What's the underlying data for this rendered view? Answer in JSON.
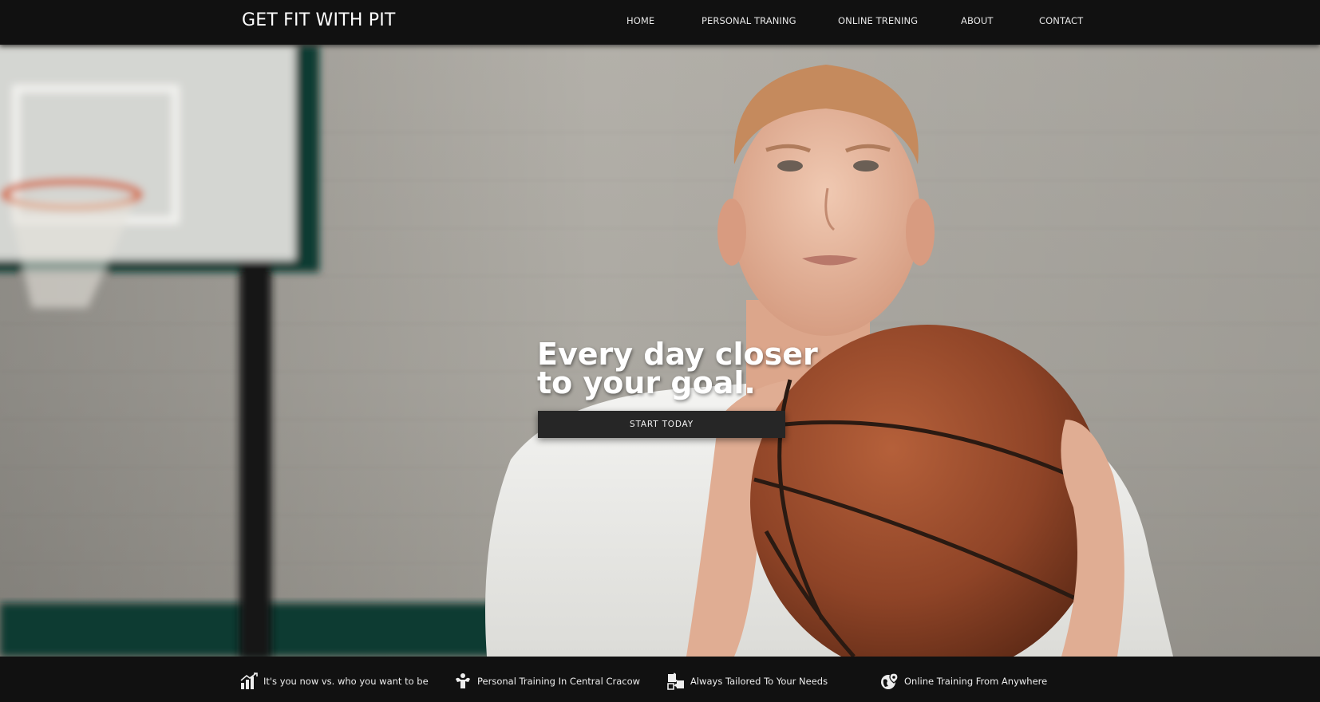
{
  "brand": "GET FIT WITH PIT",
  "nav": {
    "home": "HOME",
    "personal_training": "PERSONAL TRANING",
    "online_training": "ONLINE TRENING",
    "about": "ABOUT",
    "contact": "CONTACT"
  },
  "hero": {
    "headline_line1": "Every day closer",
    "headline_line2": "to your goal.",
    "cta_label": "START TODAY",
    "image_icon": "man-holding-basketball-photo"
  },
  "features": [
    {
      "icon": "bar-chart-icon",
      "label": "It's you now vs. who you want to be"
    },
    {
      "icon": "flexing-person-icon",
      "label": "Personal Training In Central Cracow"
    },
    {
      "icon": "puzzle-piece-icon",
      "label": "Always Tailored To Your Needs"
    },
    {
      "icon": "globe-pin-icon",
      "label": "Online Training From Anywhere"
    }
  ],
  "colors": {
    "nav_bg": "#111111",
    "cta_bg": "#262626",
    "text": "#ffffff"
  }
}
